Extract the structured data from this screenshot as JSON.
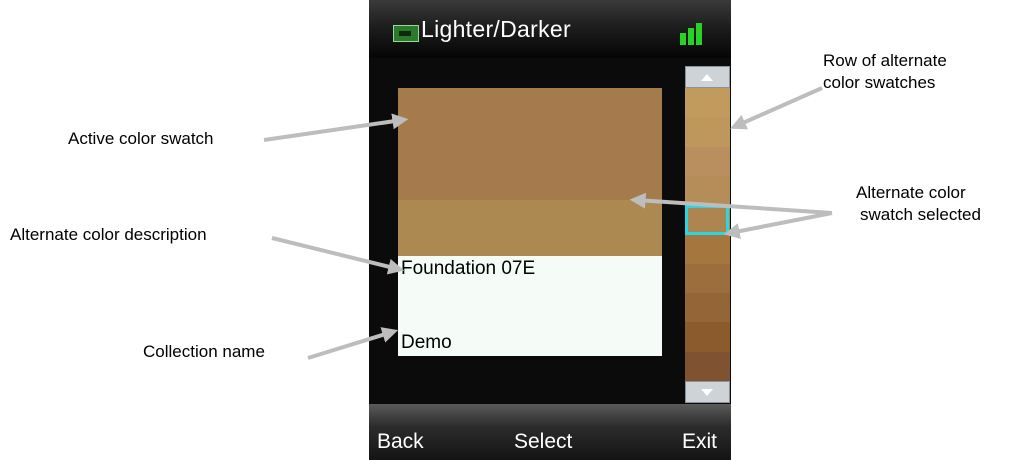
{
  "annotations": {
    "row_alt_line1": "Row of alternate",
    "row_alt_line2": "color swatches",
    "active_swatch": "Active color swatch",
    "alt_selected_line1": "Alternate color",
    "alt_selected_line2": "swatch selected",
    "alt_description": "Alternate color description",
    "collection_name": "Collection name"
  },
  "titlebar": {
    "title": "Lighter/Darker",
    "app_icon": "app-icon",
    "status_icon": "signal-icon"
  },
  "swatches": {
    "active_color": "#a57b4e",
    "alternate_color": "#ad8952"
  },
  "info": {
    "description": "Foundation 07E",
    "collection": "Demo"
  },
  "strip": {
    "colors": [
      "#c19a5d",
      "#be975d",
      "#b98f5f",
      "#b48d59",
      "#ac8551",
      "#a5773e",
      "#9d6e3d",
      "#946536",
      "#8c5b2c",
      "#7f5231"
    ],
    "selected_index": 4,
    "up_icon": "arrow-up-icon",
    "down_icon": "arrow-down-icon"
  },
  "softkeys": {
    "left": "Back",
    "center": "Select",
    "right": "Exit"
  },
  "colors": {
    "selection": "#28d7e3",
    "signal": "#28d028",
    "panel": "#f5fbf6"
  }
}
